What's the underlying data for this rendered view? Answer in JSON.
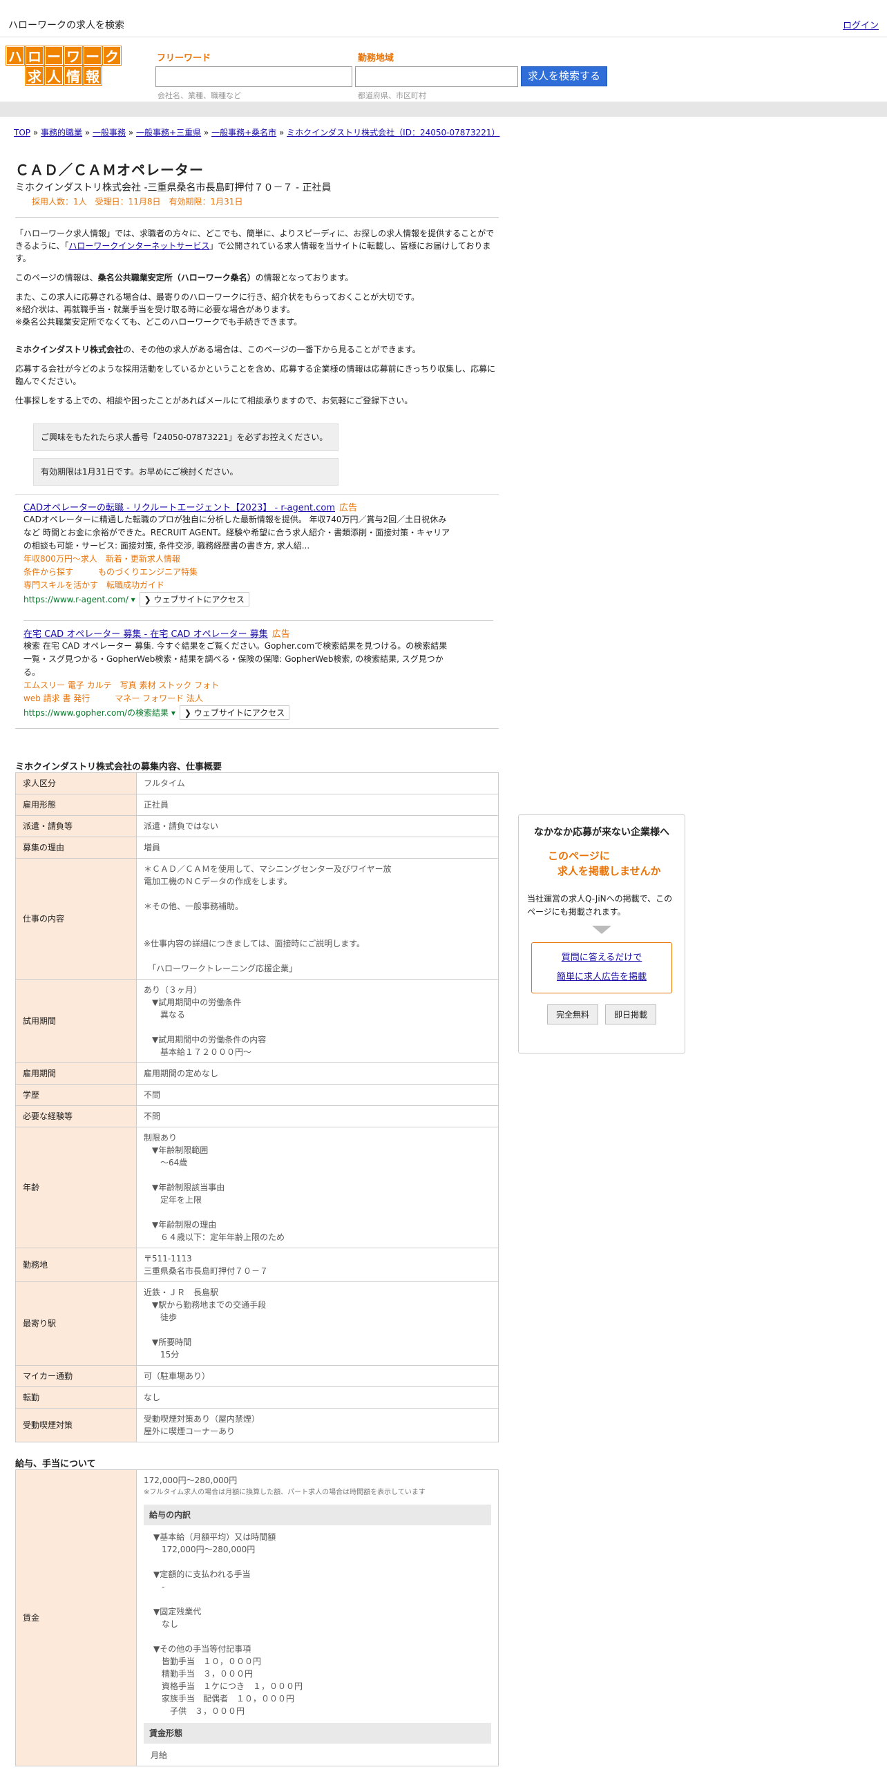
{
  "topbar": {
    "title": "ハローワークの求人を検索",
    "login": "ログイン"
  },
  "logo": {
    "row1": [
      "ハ",
      "ロ",
      "ー",
      "ワ",
      "ー",
      "ク"
    ],
    "row2": [
      "求",
      "人",
      "情",
      "報"
    ]
  },
  "search": {
    "freeword_label": "フリーワード",
    "freeword_placeholder": "会社名、業種、職種など",
    "area_label": "勤務地域",
    "area_placeholder": "都道府県、市区町村",
    "button": "求人を検索する"
  },
  "breadcrumb": [
    "TOP",
    "事務的職業",
    "一般事務",
    "一般事務+三重県",
    "一般事務+桑名市",
    "ミホクインダストリ株式会社（ID：24050-07873221）"
  ],
  "breadcrumb_sep": "»",
  "job": {
    "title": "ＣＡＤ／ＣＡＭオペレーター",
    "subtitle": "ミホクインダストリ株式会社 -三重県桑名市長島町押付７０－７ - 正社員",
    "meta": "採用人数：1人　受理日：11月8日　有効期限：1月31日"
  },
  "intro": {
    "p1a": "「ハローワーク求人情報」では、求職者の方々に、どこでも、簡単に、よりスピーディに、お探しの求人情報を提供することができるように、「",
    "p1link": "ハローワークインターネットサービス",
    "p1b": "」で公開されている求人情報を当サイトに転載し、皆様にお届けしております。",
    "p2a": "このページの情報は、",
    "p2b": "桑名公共職業安定所（ハローワーク桑名）",
    "p2c": "の情報となっております。",
    "p3l1": "また、この求人に応募される場合は、最寄りのハローワークに行き、紹介状をもらっておくことが大切です。",
    "p3l2": "※紹介状は、再就職手当・就業手当を受け取る時に必要な場合があります。",
    "p3l3": "※桑名公共職業安定所でなくても、どこのハローワークでも手続きできます。",
    "p4a": "ミホクインダストリ株式会社",
    "p4b": "の、その他の求人がある場合は、このページの一番下から見ることができます。",
    "p5": "応募する会社が今どのような採用活動をしているかということを含め、応募する企業様の情報は応募前にきっちり収集し、応募に臨んでください。",
    "p6": "仕事探しをする上での、相談や困ったことがあればメールにて相談承りますので、お気軽にご登録下さい。",
    "box1": "ご興味をもたれたら求人番号「24050-07873221」を必ずお控えください。",
    "box2": "有効期限は1月31日です。お早めにご検討ください。"
  },
  "ads": [
    {
      "title": "CADオペレーターの転職 - リクルートエージェント【2023】 - r-agent.com",
      "badge": "広告",
      "desc": "CADオペレーターに精通した転職のプロが独自に分析した最新情報を提供。 年収740万円／賞与2回／土日祝休みなど 時間とお金に余裕ができた。RECRUIT AGENT。経験や希望に合う求人紹介・書類添削・面接対策・キャリアの相談も可能・サービス: 面接対策, 条件交渉, 職務経歴書の書き方, 求人紹...",
      "links": [
        "年収800万円～求人　新着・更新求人情報",
        "条件から探す　　　ものづくりエンジニア特集",
        "専門スキルを活かす　転職成功ガイド"
      ],
      "url": "https://www.r-agent.com/ ▾",
      "visit": "❯ ウェブサイトにアクセス"
    },
    {
      "title": "在宅 CAD オペレーター 募集 - 在宅 CAD オペレーター 募集",
      "badge": "広告",
      "desc": "検索 在宅 CAD オペレーター 募集. 今すぐ結果をご覧ください。Gopher.comで検索結果を見つける。の検索結果一覧・スグ見つかる・GopherWeb検索・結果を調べる・保険の保障: GopherWeb検索, の検索結果, スグ見つかる。",
      "links": [
        "エムスリー 電子 カルテ　写真 素材 ストック フォト",
        "web 請求 書 発行　　　マネー フォワード 法人"
      ],
      "url": "https://www.gopher.com/の検索結果 ▾",
      "visit": "❯ ウェブサイトにアクセス"
    }
  ],
  "section1": {
    "title": "ミホクインダストリ株式会社の募集内容、仕事概要",
    "rows": [
      {
        "k": "求人区分",
        "v": [
          "フルタイム"
        ]
      },
      {
        "k": "雇用形態",
        "v": [
          "正社員"
        ]
      },
      {
        "k": "派遣・請負等",
        "v": [
          "派遣・請負ではない"
        ]
      },
      {
        "k": "募集の理由",
        "v": [
          "増員"
        ]
      },
      {
        "k": "仕事の内容",
        "v": [
          "＊ＣＡＤ／ＣＡＭを使用して、マシニングセンター及びワイヤー放",
          "電加工機のＮＣデータの作成をします。",
          "",
          "＊その他、一般事務補助。",
          "",
          "",
          "※仕事内容の詳細につきましては、面接時にご説明します。",
          "",
          "　「ハローワークトレーニング応援企業」"
        ]
      },
      {
        "k": "試用期間",
        "v": [
          "あり（３ヶ月）",
          "　▼試用期間中の労働条件",
          "　　異なる",
          "",
          "　▼試用期間中の労働条件の内容",
          "　　基本給１７２０００円～"
        ]
      },
      {
        "k": "雇用期間",
        "v": [
          "雇用期間の定めなし"
        ]
      },
      {
        "k": "学歴",
        "v": [
          "不問"
        ]
      },
      {
        "k": "必要な経験等",
        "v": [
          "不問"
        ]
      },
      {
        "k": "年齢",
        "v": [
          "制限あり",
          "　▼年齢制限範囲",
          "　　〜64歳",
          "",
          "　▼年齢制限該当事由",
          "　　定年を上限",
          "",
          "　▼年齢制限の理由",
          "　　６４歳以下：定年年齢上限のため"
        ]
      },
      {
        "k": "勤務地",
        "v": [
          "〒511-1113",
          "三重県桑名市長島町押付７０－７"
        ]
      },
      {
        "k": "最寄り駅",
        "v": [
          "近鉄・ＪＲ　長島駅",
          "　▼駅から勤務地までの交通手段",
          "　　徒歩",
          "",
          "　▼所要時間",
          "　　15分"
        ]
      },
      {
        "k": "マイカー通勤",
        "v": [
          "可（駐車場あり）"
        ]
      },
      {
        "k": "転勤",
        "v": [
          "なし"
        ]
      },
      {
        "k": "受動喫煙対策",
        "v": [
          "受動喫煙対策あり（屋内禁煙）",
          "屋外に喫煙コーナーあり"
        ]
      }
    ]
  },
  "section2": {
    "title": "給与、手当について",
    "wage_key": "賃金",
    "wage_range": "172,000円〜280,000円",
    "wage_note": "※フルタイム求人の場合は月額に換算した額、パート求人の場合は時間額を表示しています",
    "breakdown_title": "給与の内訳",
    "breakdown": [
      "▼基本給（月額平均）又は時間額",
      "　172,000円〜280,000円",
      "",
      "▼定額的に支払われる手当",
      "　-",
      "",
      "▼固定残業代",
      "　なし",
      "",
      "▼その他の手当等付記事項",
      "　皆勤手当　１０，０００円",
      "　精勤手当　３，０００円",
      "　資格手当　１ケにつき　１，０００円",
      "　家族手当　配偶者　１０，０００円",
      "　　子供　３，０００円"
    ],
    "form_title": "賃金形態",
    "form_value": "月給"
  },
  "sidebar": {
    "heading": "なかなか応募が来ない企業様へ",
    "catch1": "このページに",
    "catch2": "求人を掲載しませんか",
    "text": "当社運営の求人Q-JiNへの掲載で、このページにも掲載されます。",
    "link1": "質問に答えるだけで",
    "link2": "簡単に求人広告を掲載",
    "btn1": "完全無料",
    "btn2": "即日掲載"
  }
}
